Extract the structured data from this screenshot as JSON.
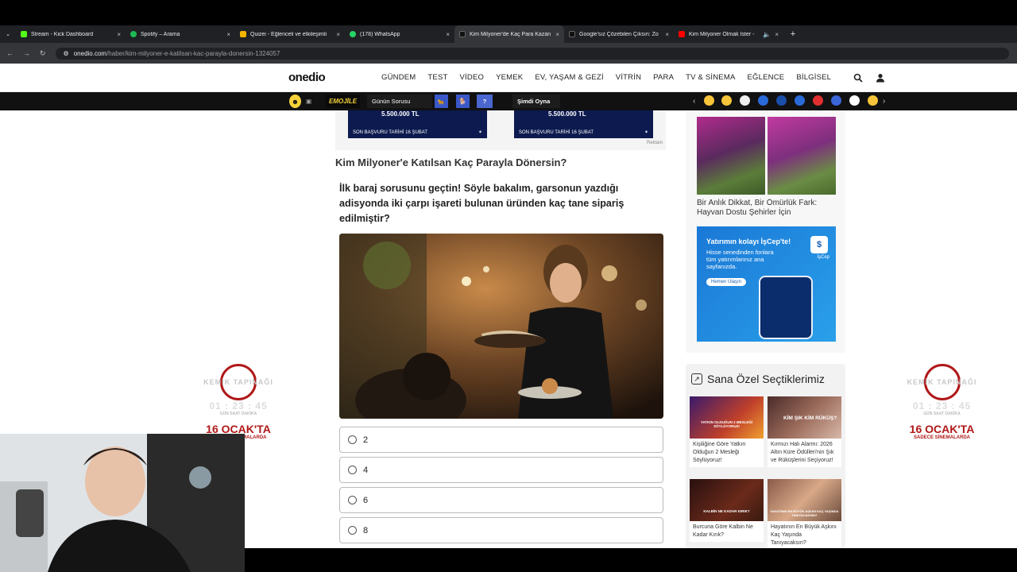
{
  "browser": {
    "tabs": [
      {
        "title": "Stream - Kick Dashboard",
        "favicon_color": "#53fc18",
        "active": false
      },
      {
        "title": "Spotify – Arama",
        "favicon_color": "#1db954",
        "active": false
      },
      {
        "title": "Quizei - Eğlenceli ve etkileşimli",
        "favicon_color": "#f4b400",
        "active": false
      },
      {
        "title": "(178) WhatsApp",
        "favicon_color": "#25d366",
        "active": false
      },
      {
        "title": "Kim Milyoner'de Kaç Para Kazan",
        "favicon_color": "#111111",
        "active": true
      },
      {
        "title": "Google'sız Çözebilen Çıksın: Zo",
        "favicon_color": "#111111",
        "active": false
      },
      {
        "title": "Kim Milyoner Olmak İster -",
        "favicon_color": "#ff0000",
        "active": false
      }
    ],
    "url_host": "onedio.com",
    "url_path": "/haber/kim-milyoner-e-katilsan-kac-parayla-donersin-1324057",
    "new_tab": "+",
    "close": "×"
  },
  "site": {
    "logo": "onedio",
    "nav": [
      "GÜNDEM",
      "TEST",
      "VİDEO",
      "YEMEK",
      "EV, YAŞAM & GEZİ",
      "VİTRİN",
      "PARA",
      "TV & SİNEMA",
      "EĞLENCE",
      "BİLGİSEL"
    ]
  },
  "emojibar": {
    "emojile": "EMOJİLE",
    "gunun_sorusu": "Günün Sorusu",
    "question_mark": "?",
    "simdi_oyna": "Şimdi Oyna"
  },
  "ads": {
    "amount": "5.500.000 TL",
    "small_text": "SON BAŞVURU TARİHİ 16 ŞUBAT",
    "reklam": "Reklam"
  },
  "article": {
    "heading": "Kim Milyoner'e Katılsan Kaç Parayla Dönersin?",
    "question": "İlk baraj sorusunu geçtin! Söyle bakalım, garsonun yazdığı adisyonda iki çarpı işareti bulunan üründen kaç tane sipariş edilmiştir?",
    "options": [
      "2",
      "4",
      "6",
      "8"
    ]
  },
  "sidebar": {
    "card_caption": "Bir Anlık Dikkat, Bir Ömürlük Fark: Hayvan Dostu Şehirler İçin",
    "isbank": {
      "headline": "Yatırımın kolayı İşCep'te!",
      "body": "Hisse senedinden fonlara tüm yatırımlarınız ana sayfanızda.",
      "button": "Hemen Ulaşın",
      "brand": "İşCep"
    },
    "picks_title": "Sana Özel Seçtiklerimiz",
    "picks": [
      {
        "caption": "Kişiliğine Göre Yatkın Olduğun 2 Mesleği Söylüyoruz!",
        "overlay": "YATKIN OLDUĞUN 2 MESLEĞİ SÖYLÜYORUZ!"
      },
      {
        "caption": "Kırmızı Halı Alarmı: 2026 Altın Küre Ödülleri'nin Şık ve Rüküşlerini Seçiyoruz!",
        "overlay": "KİM ŞIK KİM RÜKÜŞ?"
      },
      {
        "caption": "Burcuna Göre Kalbin Ne Kadar Kırık?",
        "overlay": "KALBİN NE KADAR KIRIK?"
      },
      {
        "caption": "Hayatının En Büyük Aşkını Kaç Yaşında Tanıyacaksın?",
        "overlay": "HAYATININ EN BÜYÜK AŞKINI KAÇ YAŞINDA TANIYACAKSIN?"
      }
    ]
  },
  "promo": {
    "title": "KEMİK TAPINAĞI",
    "countdown": "01 : 23 : 45",
    "units": "GÜN   SAAT   DAKİKA",
    "date": "16 OCAK'TA",
    "sub": "SADECE SİNEMALARDA"
  }
}
